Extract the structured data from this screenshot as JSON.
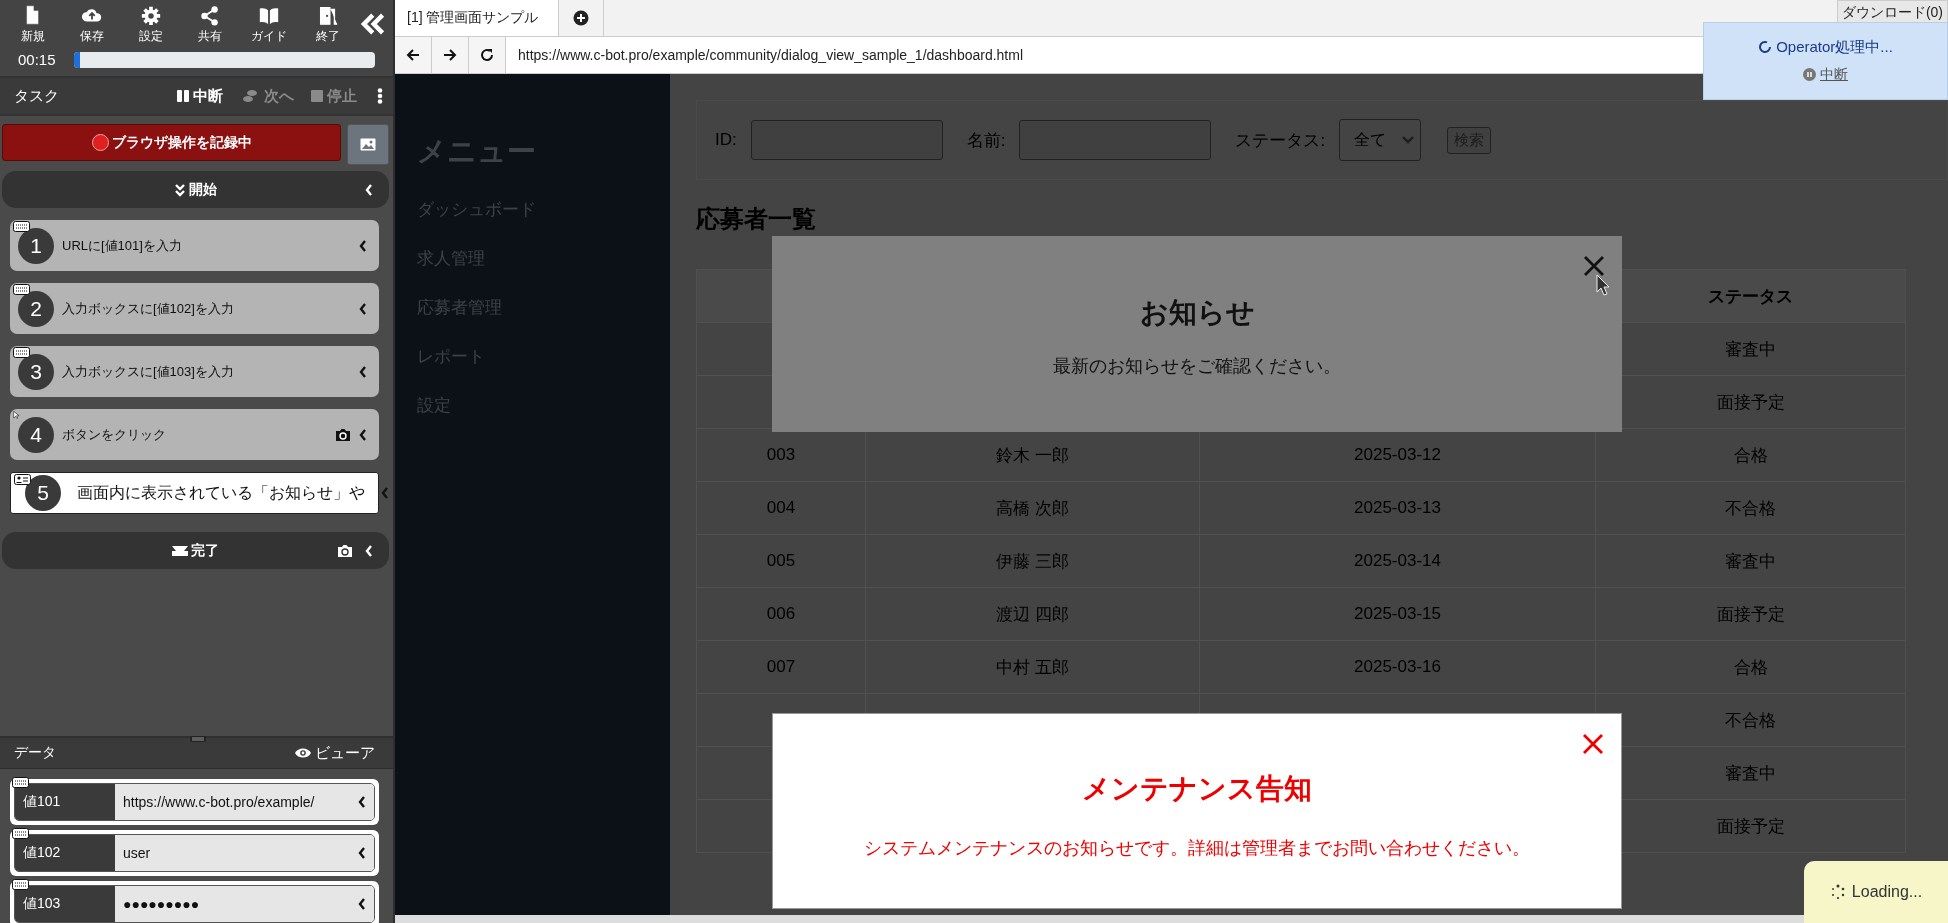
{
  "toolbar": {
    "buttons": [
      {
        "label": "新規"
      },
      {
        "label": "保存"
      },
      {
        "label": "設定"
      },
      {
        "label": "共有"
      },
      {
        "label": "ガイド"
      },
      {
        "label": "終了"
      }
    ]
  },
  "timer": {
    "time": "00:15",
    "level": 0.02
  },
  "task_header": {
    "title": "タスク",
    "actions": [
      {
        "label": "中断",
        "disabled": false
      },
      {
        "label": "次へ",
        "disabled": true
      },
      {
        "label": "停止",
        "disabled": true
      }
    ]
  },
  "record_button": {
    "label": "ブラウザ操作を記録中"
  },
  "start_bar": {
    "label": "開始"
  },
  "steps": [
    {
      "number": "1",
      "text": "URLに[値101]を入力",
      "kind": "input",
      "camera": false,
      "selected": false
    },
    {
      "number": "2",
      "text": "入力ボックスに[値102]を入力",
      "kind": "input",
      "camera": false,
      "selected": false
    },
    {
      "number": "3",
      "text": "入力ボックスに[値103]を入力",
      "kind": "input",
      "camera": false,
      "selected": false
    },
    {
      "number": "4",
      "text": "ボタンをクリック",
      "kind": "click",
      "camera": true,
      "selected": false
    },
    {
      "number": "5",
      "text": "画面内に表示されている「お知らせ」や",
      "kind": "ai",
      "camera": false,
      "selected": true
    }
  ],
  "end_bar": {
    "label": "完了",
    "camera": true
  },
  "data_panel": {
    "title": "データ",
    "viewer": "ビューア",
    "items": [
      {
        "name": "値101",
        "value": "https://www.c-bot.pro/example/"
      },
      {
        "name": "値102",
        "value": "user"
      },
      {
        "name": "値103",
        "value": "●●●●●●●●●"
      }
    ]
  },
  "browser": {
    "tabs": [
      {
        "label": "[1] 管理画面サンプル",
        "selected": true
      }
    ],
    "url": "https://www.c-bot.pro/example/community/dialog_view_sample_1/dashboard.html",
    "download": "ダウンロード(0)"
  },
  "operator": {
    "status": "Operator処理中...",
    "stop": "中断"
  },
  "page": {
    "menu_title": "メニュー",
    "menu": [
      "ダッシュボード",
      "求人管理",
      "応募者管理",
      "レポート",
      "設定"
    ],
    "search": {
      "id_label": "ID:",
      "name_label": "名前:",
      "status_label": "ステータス:",
      "status_value": "全て",
      "button": "検索"
    },
    "title": "応募者一覧",
    "status_column": "ステータス",
    "rows": [
      {
        "status": "審査中"
      },
      {
        "status": "面接予定"
      },
      {
        "id": "003",
        "name": "鈴木 一郎",
        "date": "2025-03-12",
        "status": "合格"
      },
      {
        "id": "004",
        "name": "高橋 次郎",
        "date": "2025-03-13",
        "status": "不合格"
      },
      {
        "id": "005",
        "name": "伊藤 三郎",
        "date": "2025-03-14",
        "status": "審査中"
      },
      {
        "id": "006",
        "name": "渡辺 四郎",
        "date": "2025-03-15",
        "status": "面接予定"
      },
      {
        "id": "007",
        "name": "中村 五郎",
        "date": "2025-03-16",
        "status": "合格"
      },
      {
        "status": "不合格"
      },
      {
        "status": "審査中"
      },
      {
        "status": "面接予定"
      }
    ]
  },
  "dialogs": [
    {
      "kind": "notice",
      "title": "お知らせ",
      "message": "最新のお知らせをご確認ください。"
    },
    {
      "kind": "alert",
      "title": "メンテナンス告知",
      "message": "システムメンテナンスのお知らせです。詳細は管理者までお問い合わせください。"
    }
  ],
  "loading": "Loading..."
}
